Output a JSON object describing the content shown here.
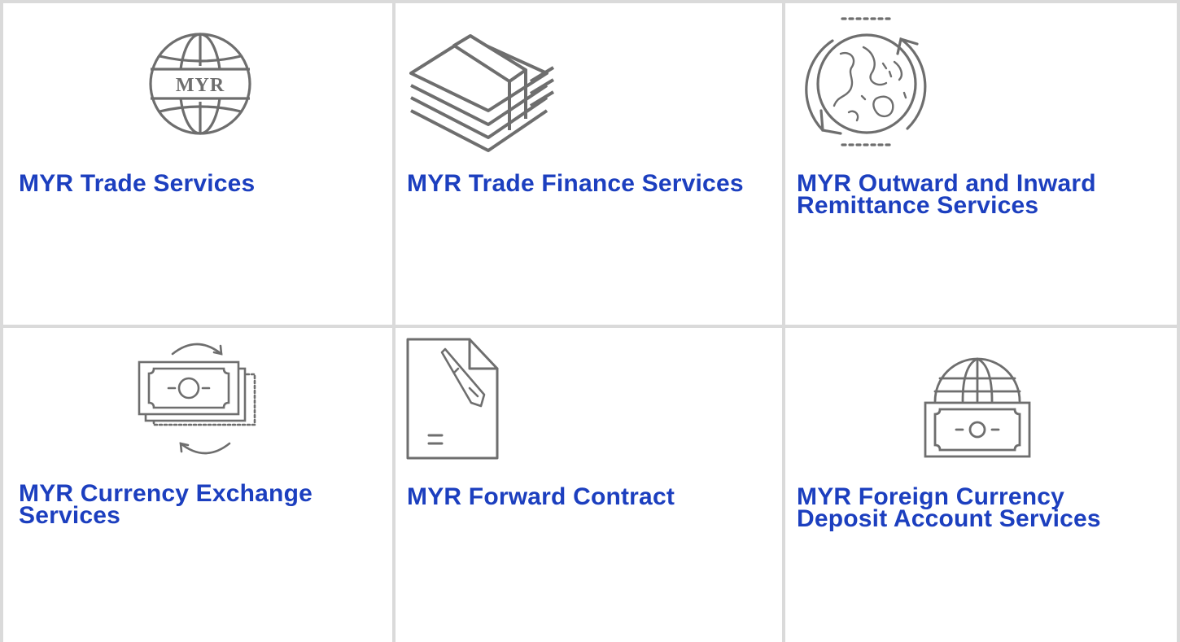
{
  "services": [
    {
      "title": "MYR Trade Services",
      "icon": "globe-myr-icon",
      "icon_text": "MYR"
    },
    {
      "title": "MYR Trade Finance Services",
      "icon": "banknote-stack-icon"
    },
    {
      "title": "MYR Outward and Inward Remittance Services",
      "icon": "globe-rotation-arrows-icon"
    },
    {
      "title": "MYR Currency Exchange Services",
      "icon": "currency-exchange-icon"
    },
    {
      "title": "MYR Forward Contract",
      "icon": "contract-document-pen-icon"
    },
    {
      "title": "MYR Foreign Currency Deposit Account Services",
      "icon": "globe-banknote-icon"
    }
  ],
  "colors": {
    "link": "#1c3fbf",
    "icon_stroke": "#6e6e6e",
    "grid_line": "#dadada"
  }
}
